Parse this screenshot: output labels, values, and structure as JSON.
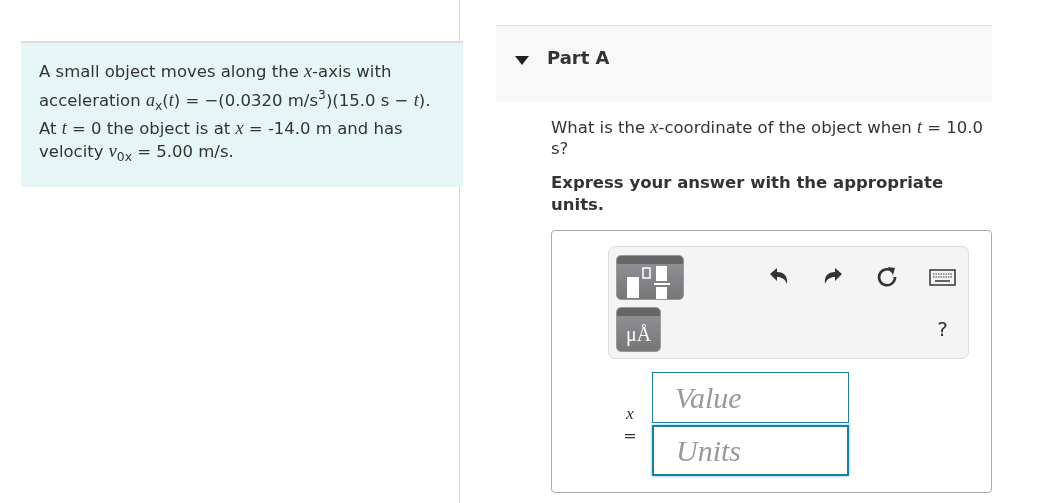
{
  "problem": {
    "text": "A small object moves along the *x*-axis with acceleration *a*$_{x}$(*t*) = −(0.0320 m/s$^{3}$)(15.0 s − *t*). At *t* = 0 the object is at *x* = -14.0 m and has velocity *v*$_{0x}$ = 5.00 m/s."
  },
  "part": {
    "title": "Part A",
    "expanded": true,
    "question": "What is the *x*-coordinate of the object when *t* = 10.0 s?",
    "instruction": "Express your answer with the appropriate units.",
    "toolbar": {
      "units_button": "μÅ",
      "help": "?"
    },
    "answer_label": "*x* =",
    "fields": [
      {
        "placeholder": "Value",
        "focused": false
      },
      {
        "placeholder": "Units",
        "focused": true
      }
    ]
  }
}
